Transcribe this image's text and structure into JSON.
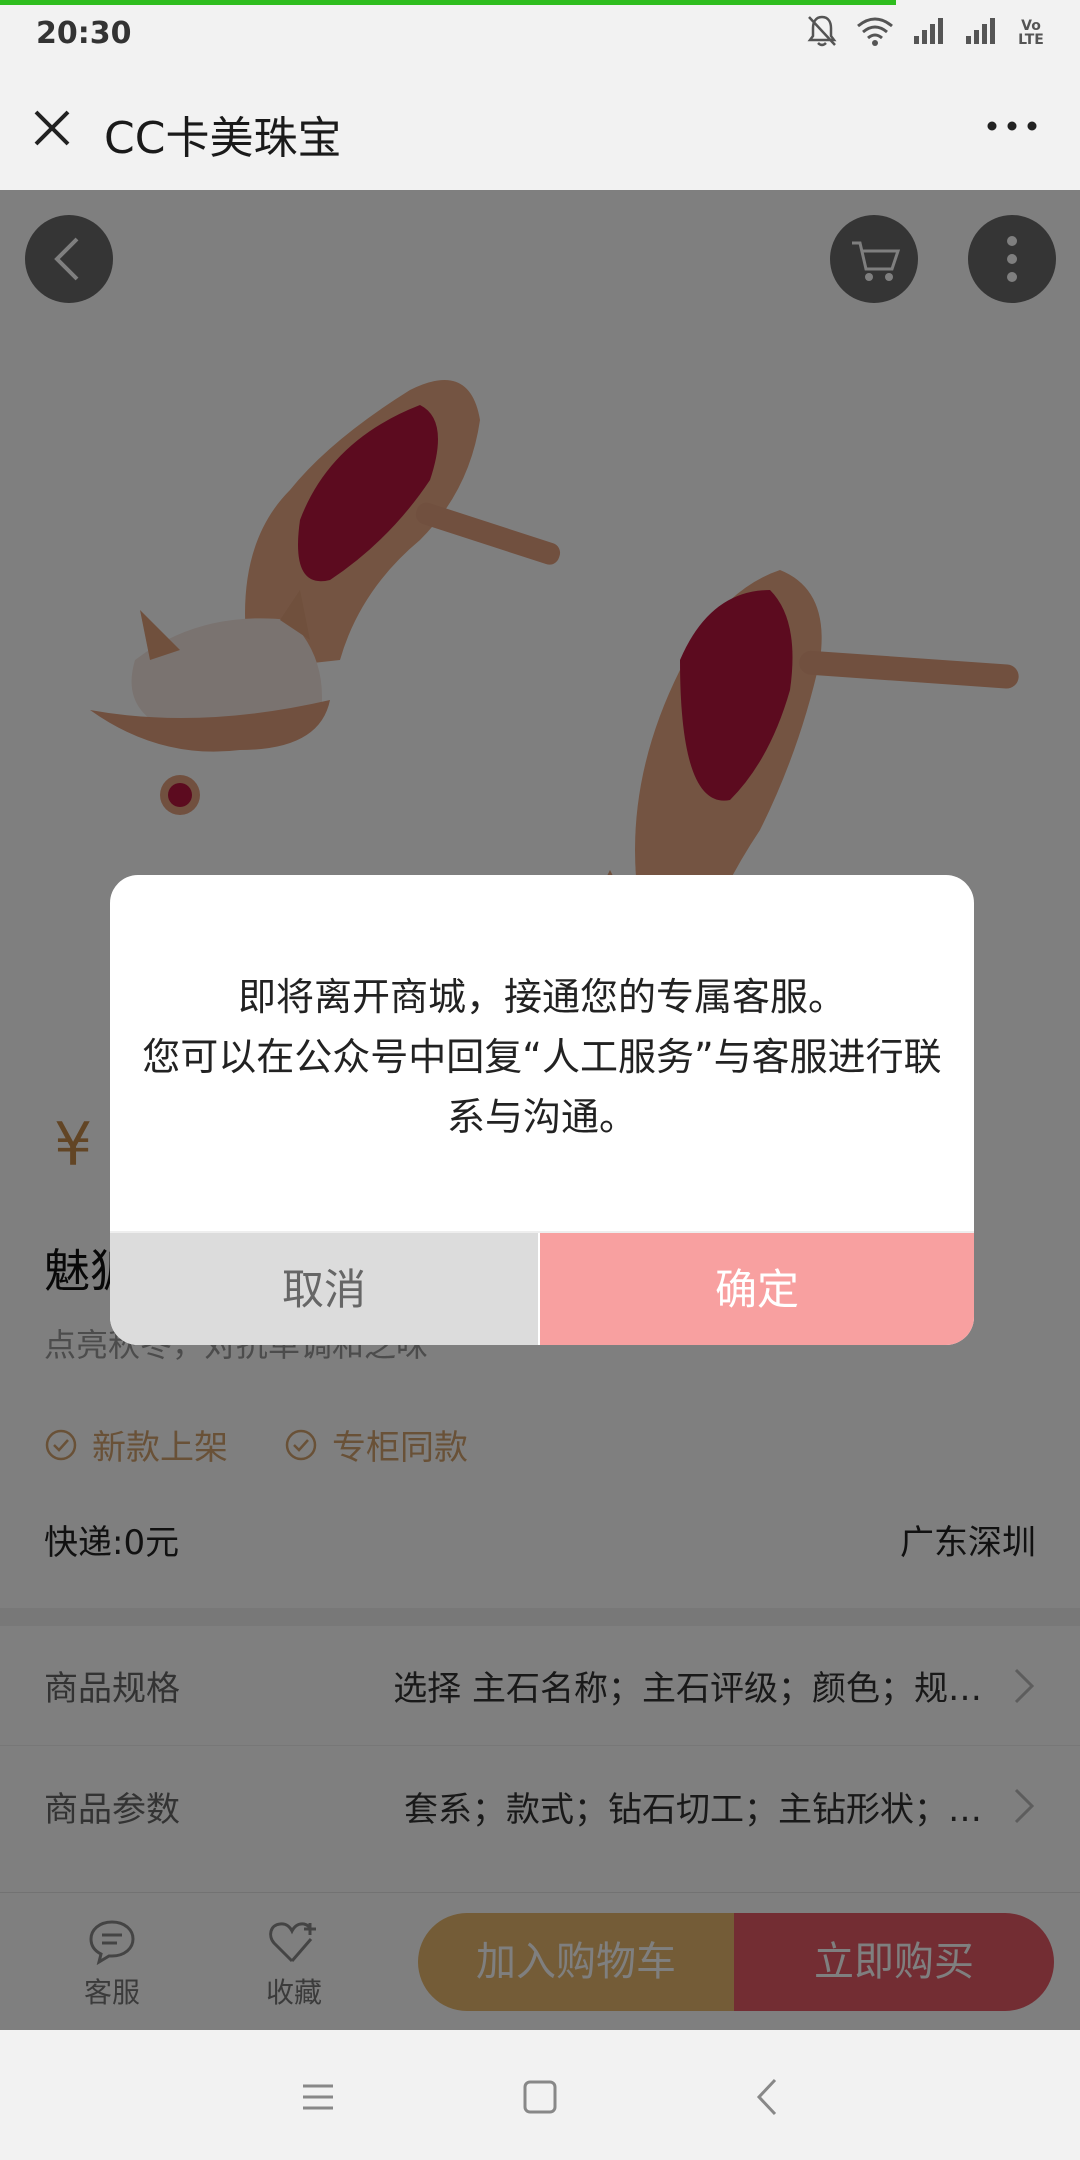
{
  "status_bar": {
    "time": "20:30",
    "icons": [
      "mute-bell-icon",
      "wifi-icon",
      "signal-icon",
      "signal-icon",
      "volte-icon"
    ],
    "volte_text": "Vo LTE",
    "progress_fraction": 0.83,
    "progress_color": "#2fbd1f"
  },
  "webview": {
    "title": "CC卡美珠宝",
    "close_icon": "close-icon",
    "more_icon": "more-dots-icon"
  },
  "product": {
    "nav_icons": [
      "back-arrow-icon",
      "shopping-cart-icon",
      "vertical-dots-icon"
    ],
    "price_fragment": "¥ (",
    "name_fragment": "魅狐",
    "description": "点亮秋冬，对抗单调和乏味",
    "tags": [
      "新款上架",
      "专柜同款"
    ],
    "shipping": "快递:0元",
    "location": "广东深圳",
    "specs": [
      {
        "label": "商品规格",
        "value": "选择 主石名称；主石评级；颜色；规…"
      },
      {
        "label": "商品参数",
        "value": "套系；款式；钻石切工；主钻形状；…"
      }
    ]
  },
  "action_bar": {
    "service": "客服",
    "favorite": "收藏",
    "add_to_cart": "加入购物车",
    "buy_now": "立即购买"
  },
  "modal": {
    "line1": "即将离开商城，接通您的专属客服。",
    "line2": "您可以在公众号中回复“人工服务”与客服进行联系与沟通。",
    "cancel": "取消",
    "confirm": "确定"
  },
  "colors": {
    "accent_gold": "#e8b96e",
    "accent_red": "#e65a66",
    "confirm_pink": "#f8a0a0"
  }
}
